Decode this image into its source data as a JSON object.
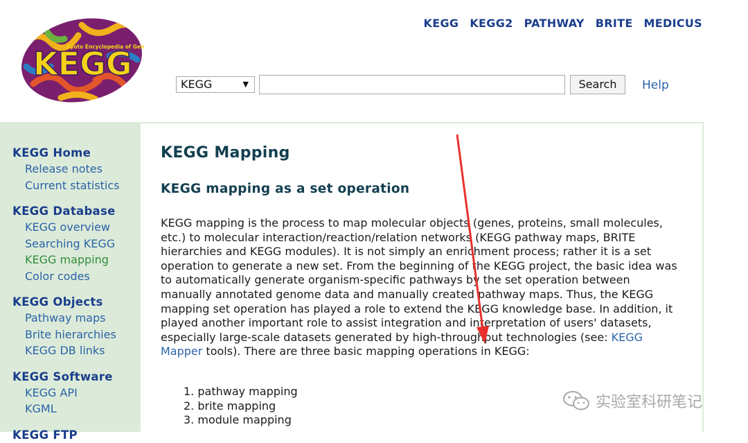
{
  "logo": {
    "text_main": "KEGG",
    "text_sub": "Kyoto Encyclopedia of Genes and Genomes"
  },
  "top_nav": [
    "KEGG",
    "KEGG2",
    "PATHWAY",
    "BRITE",
    "MEDICUS"
  ],
  "search": {
    "db_selected": "KEGG",
    "query_value": "",
    "button_label": "Search",
    "help_label": "Help"
  },
  "sidebar": {
    "groups": [
      {
        "title": "KEGG Home",
        "items": [
          "Release notes",
          "Current statistics"
        ]
      },
      {
        "title": "KEGG Database",
        "items": [
          "KEGG overview",
          "Searching KEGG",
          "KEGG mapping",
          "Color codes"
        ]
      },
      {
        "title": "KEGG Objects",
        "items": [
          "Pathway maps",
          "Brite hierarchies",
          "KEGG DB links"
        ]
      },
      {
        "title": "KEGG Software",
        "items": [
          "KEGG API",
          "KGML"
        ]
      }
    ],
    "current_item": "KEGG mapping",
    "cut_heading": "KEGG FTP"
  },
  "main": {
    "title": "KEGG Mapping",
    "section_title": "KEGG mapping as a set operation",
    "para_before_link": "KEGG mapping is the process to map molecular objects (genes, proteins, small molecules, etc.) to molecular interaction/reaction/relation networks (KEGG pathway maps, BRITE hierarchies and KEGG modules). It is not simply an enrichment process; rather it is a set operation to generate a new set. From the beginning of the KEGG project, the basic idea was to automatically generate organism-specific pathways by the set operation between manually annotated genome data and manually created pathway maps. Thus, the KEGG mapping set operation has played a role to extend the KEGG knowledge base. In addition, it played another important role to assist integration and interpretation of users' datasets, especially large-scale datasets generated by high-throughput technologies (see: ",
    "para_link": "KEGG Mapper",
    "para_after_link": " tools). There are three basic mapping operations in KEGG:",
    "list_items": [
      "1. pathway mapping",
      "2. brite mapping",
      "3. module mapping"
    ]
  },
  "watermark": "实验室科研笔记",
  "colors": {
    "nav": "#1a3e8c",
    "link": "#2a62a8",
    "heading": "#123f4f",
    "sidebar_bg": "#dcebd9",
    "arrow": "#e8312c"
  }
}
